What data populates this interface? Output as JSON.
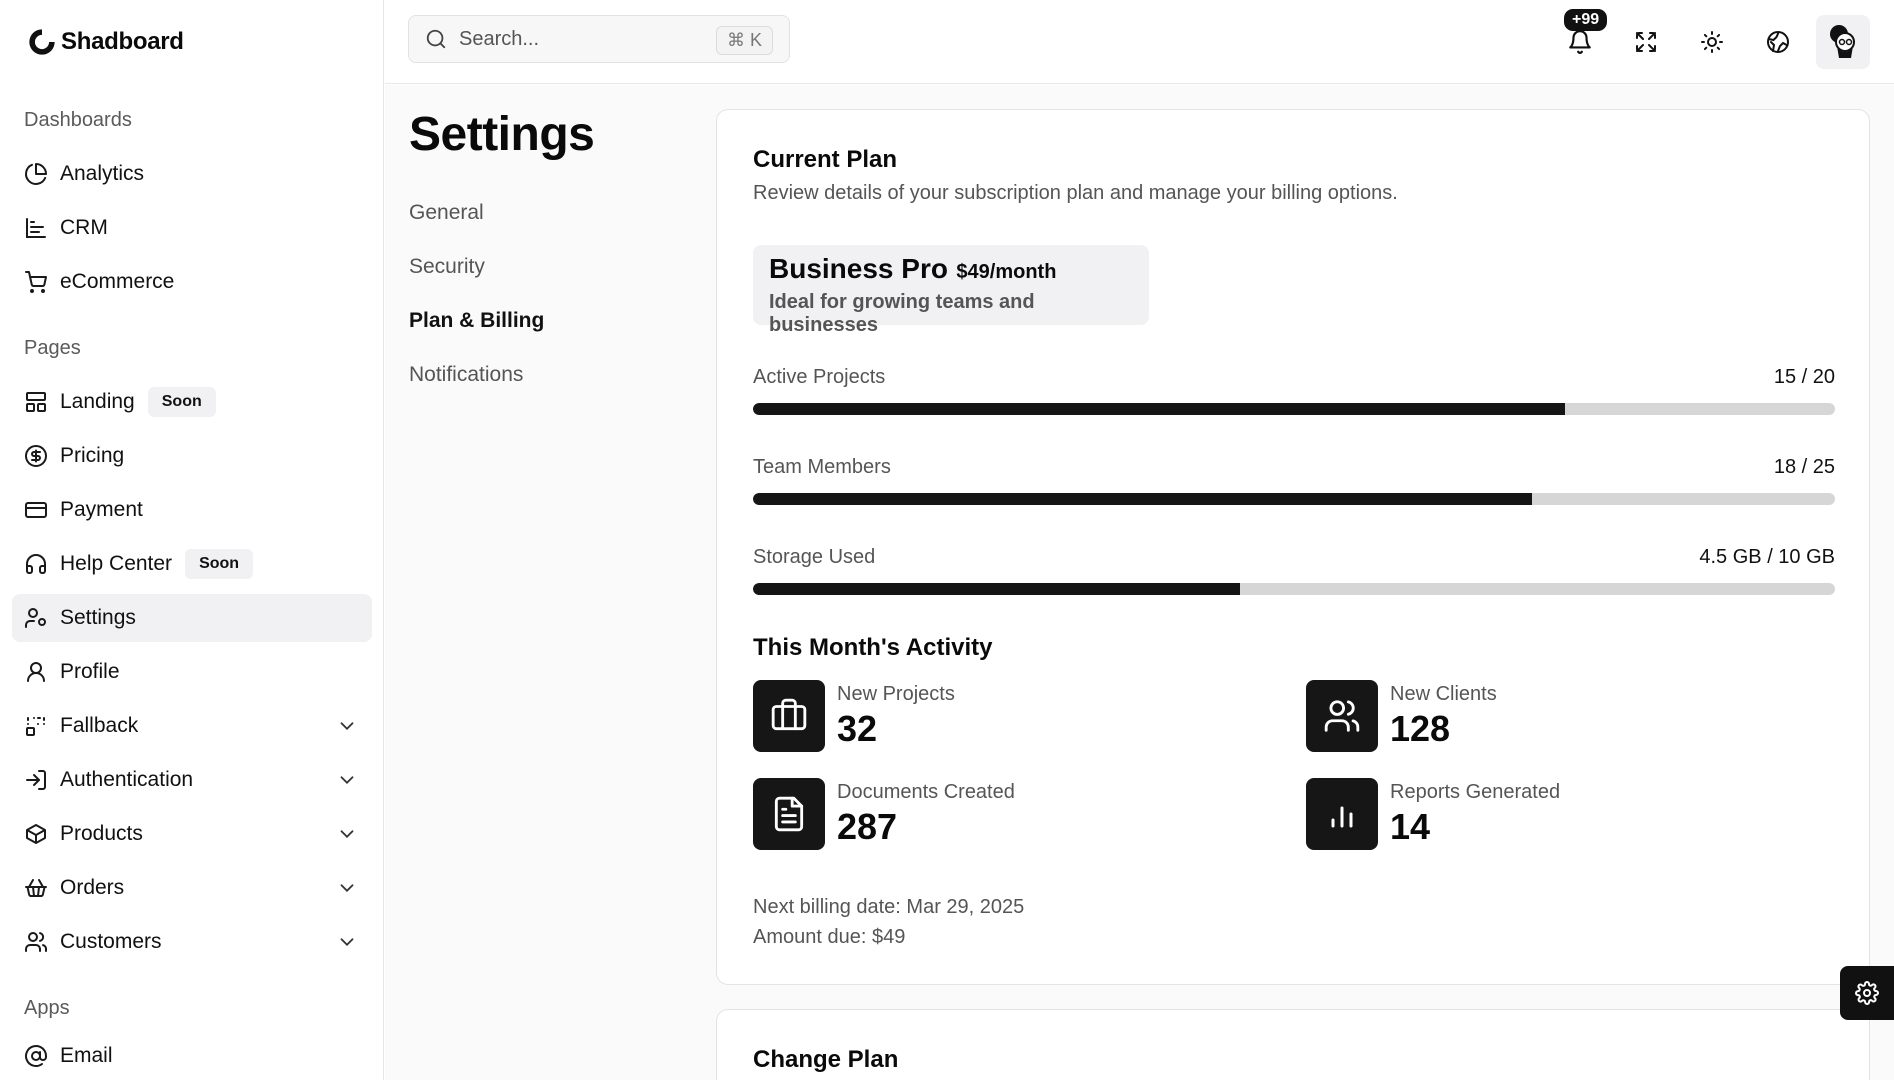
{
  "app": {
    "name": "Shadboard"
  },
  "sidebar": {
    "groups": [
      {
        "label": "Dashboards",
        "items": [
          {
            "label": "Analytics",
            "icon": "pie-chart-icon"
          },
          {
            "label": "CRM",
            "icon": "bar-chart-icon"
          },
          {
            "label": "eCommerce",
            "icon": "shopping-cart-icon"
          }
        ]
      },
      {
        "label": "Pages",
        "items": [
          {
            "label": "Landing",
            "icon": "layout-icon",
            "badge": "Soon"
          },
          {
            "label": "Pricing",
            "icon": "dollar-circle-icon"
          },
          {
            "label": "Payment",
            "icon": "credit-card-icon"
          },
          {
            "label": "Help Center",
            "icon": "headphones-icon",
            "badge": "Soon"
          },
          {
            "label": "Settings",
            "icon": "user-cog-icon",
            "active": true
          },
          {
            "label": "Profile",
            "icon": "user-icon"
          },
          {
            "label": "Fallback",
            "icon": "dashed-grid-icon",
            "expandable": true
          },
          {
            "label": "Authentication",
            "icon": "log-in-icon",
            "expandable": true
          },
          {
            "label": "Products",
            "icon": "package-icon",
            "expandable": true
          },
          {
            "label": "Orders",
            "icon": "basket-icon",
            "expandable": true
          },
          {
            "label": "Customers",
            "icon": "users-icon",
            "expandable": true
          }
        ]
      },
      {
        "label": "Apps",
        "items": [
          {
            "label": "Email",
            "icon": "at-sign-icon"
          }
        ]
      }
    ]
  },
  "topbar": {
    "search_placeholder": "Search...",
    "search_shortcut": "⌘ K",
    "notifications_badge": "+99"
  },
  "settings": {
    "title": "Settings",
    "nav": [
      {
        "label": "General"
      },
      {
        "label": "Security"
      },
      {
        "label": "Plan & Billing",
        "active": true
      },
      {
        "label": "Notifications"
      }
    ]
  },
  "current_plan": {
    "title": "Current Plan",
    "description": "Review details of your subscription plan and manage your billing options.",
    "plan_name": "Business Pro",
    "plan_price": "$49/month",
    "plan_tagline": "Ideal for growing teams and businesses",
    "usage": [
      {
        "label": "Active Projects",
        "value": "15 / 20",
        "fraction": 0.75
      },
      {
        "label": "Team Members",
        "value": "18 / 25",
        "fraction": 0.72
      },
      {
        "label": "Storage Used",
        "value": "4.5 GB / 10 GB",
        "fraction": 0.45
      }
    ],
    "activity_title": "This Month's Activity",
    "activity": [
      {
        "label": "New Projects",
        "value": "32",
        "icon": "briefcase-icon"
      },
      {
        "label": "New Clients",
        "value": "128",
        "icon": "users-icon"
      },
      {
        "label": "Documents Created",
        "value": "287",
        "icon": "file-text-icon"
      },
      {
        "label": "Reports Generated",
        "value": "14",
        "icon": "bar-chart-icon"
      }
    ],
    "next_billing": "Next billing date: Mar 29, 2025",
    "amount_due": "Amount due: $49"
  },
  "change_plan": {
    "title": "Change Plan"
  },
  "colors": {
    "accent": "#151515",
    "track": "#d6d6d6",
    "active_bg": "#f1f1f3"
  }
}
